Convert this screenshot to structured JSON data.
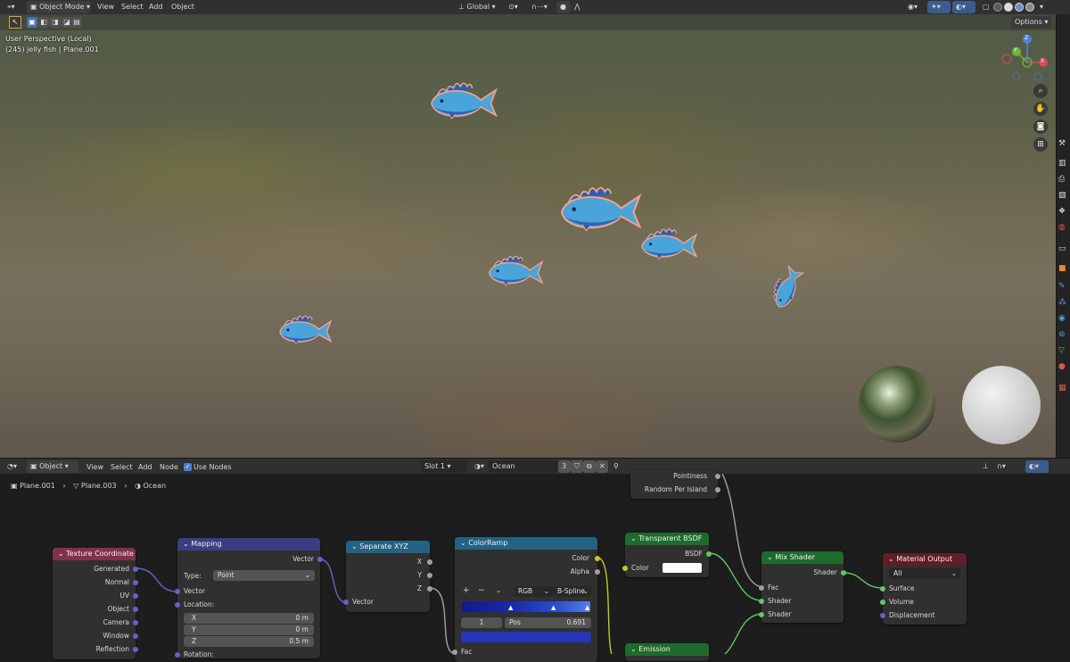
{
  "header": {
    "mode": "Object Mode",
    "menus": [
      "View",
      "Select",
      "Add",
      "Object"
    ],
    "transform_orientation": "Global",
    "options": "Options"
  },
  "viewport": {
    "perspective": "User Perspective (Local)",
    "object_info": "(245) jelly fish | Plane.001",
    "gizmo_axes": [
      "Z",
      "Y",
      "X"
    ]
  },
  "node_header": {
    "editor_type": "Object",
    "menus": [
      "View",
      "Select",
      "Add",
      "Node"
    ],
    "use_nodes": "Use Nodes",
    "slot": "Slot 1",
    "material": "Ocean",
    "users": "3"
  },
  "breadcrumb": [
    "Plane.001",
    "Plane.003",
    "Ocean"
  ],
  "nodes": {
    "texcoord": {
      "title": "Texture Coordinate",
      "outputs": [
        "Generated",
        "Normal",
        "UV",
        "Object",
        "Camera",
        "Window",
        "Reflection"
      ]
    },
    "mapping": {
      "title": "Mapping",
      "output": "Vector",
      "type_label": "Type:",
      "type_value": "Point",
      "input": "Vector",
      "location_label": "Location:",
      "loc": [
        {
          "axis": "X",
          "value": "0 m"
        },
        {
          "axis": "Y",
          "value": "0 m"
        },
        {
          "axis": "Z",
          "value": "0.5 m"
        }
      ],
      "rotation_label": "Rotation:"
    },
    "separate": {
      "title": "Separate XYZ",
      "outputs": [
        "X",
        "Y",
        "Z"
      ],
      "input": "Vector"
    },
    "colorramp": {
      "title": "ColorRamp",
      "outputs": [
        "Color",
        "Alpha"
      ],
      "mode": "RGB",
      "interp": "B-Spline",
      "index": "1",
      "pos_label": "Pos",
      "pos_value": "0.691",
      "input": "Fac"
    },
    "transparent": {
      "title": "Transparent BSDF",
      "output": "BSDF",
      "input": "Color"
    },
    "emission": {
      "title": "Emission"
    },
    "partial": {
      "rows": [
        "Pointiness",
        "Random Per Island"
      ]
    },
    "mix": {
      "title": "Mix Shader",
      "output": "Shader",
      "inputs": [
        "Fac",
        "Shader",
        "Shader"
      ]
    },
    "output": {
      "title": "Material Output",
      "target": "All",
      "inputs": [
        "Surface",
        "Volume",
        "Displacement"
      ]
    }
  },
  "colors": {
    "texcoord_header": "#83314a",
    "mapping_header": "#3c3c83",
    "converter_header": "#246283",
    "shader_header": "#1f6b2d",
    "output_header": "#611d2c"
  }
}
